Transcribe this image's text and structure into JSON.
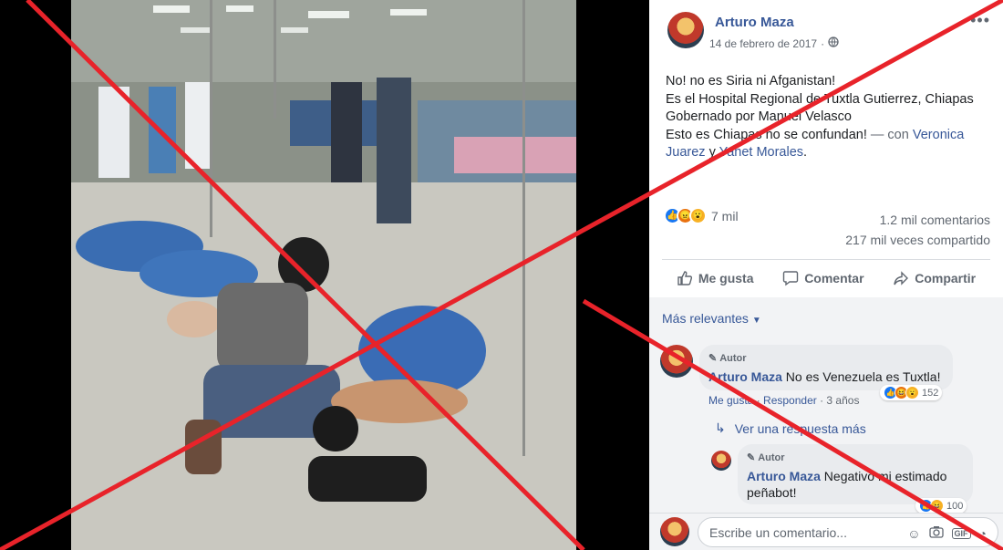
{
  "post": {
    "author": "Arturo Maza",
    "date": "14 de febrero de 2017",
    "text_lines": [
      "No! no es Siria ni Afganistan!",
      "Es el Hospital Regional de Tuxtla Gutierrez, Chiapas",
      "Gobernado por Manuel Velasco"
    ],
    "text_last_prefix": "Esto es Chiapas no se confundan!",
    "with_label": "— con",
    "tag1": "Veronica Juarez",
    "tag_join": "y",
    "tag2": "Yanet Morales",
    "tag_end": ".",
    "more_icon": "•••",
    "privacy_icon": "globe-icon"
  },
  "stats": {
    "reactions_count": "7 mil",
    "comments": "1.2 mil comentarios",
    "shares": "217 mil veces compartido",
    "reaction_types": [
      "like",
      "angry",
      "wow"
    ]
  },
  "actions": {
    "like": "Me gusta",
    "comment": "Comentar",
    "share": "Compartir"
  },
  "comments": {
    "filter": "Más relevantes",
    "items": [
      {
        "badge": "Autor",
        "name": "Arturo Maza",
        "text": "No es Venezuela es Tuxtla!",
        "like": "Me gusta",
        "reply": "Responder",
        "time": "3 años",
        "reaction_count": "152"
      },
      {
        "badge": "Autor",
        "name": "Arturo Maza",
        "text": "Negativo mi estimado",
        "text2": "peñabot!",
        "reaction_count": "100"
      }
    ],
    "more_replies": "Ver una respuesta más"
  },
  "composer": {
    "placeholder": "Escribe un comentario..."
  },
  "colors": {
    "link": "#385898",
    "cross": "#e8232a"
  }
}
